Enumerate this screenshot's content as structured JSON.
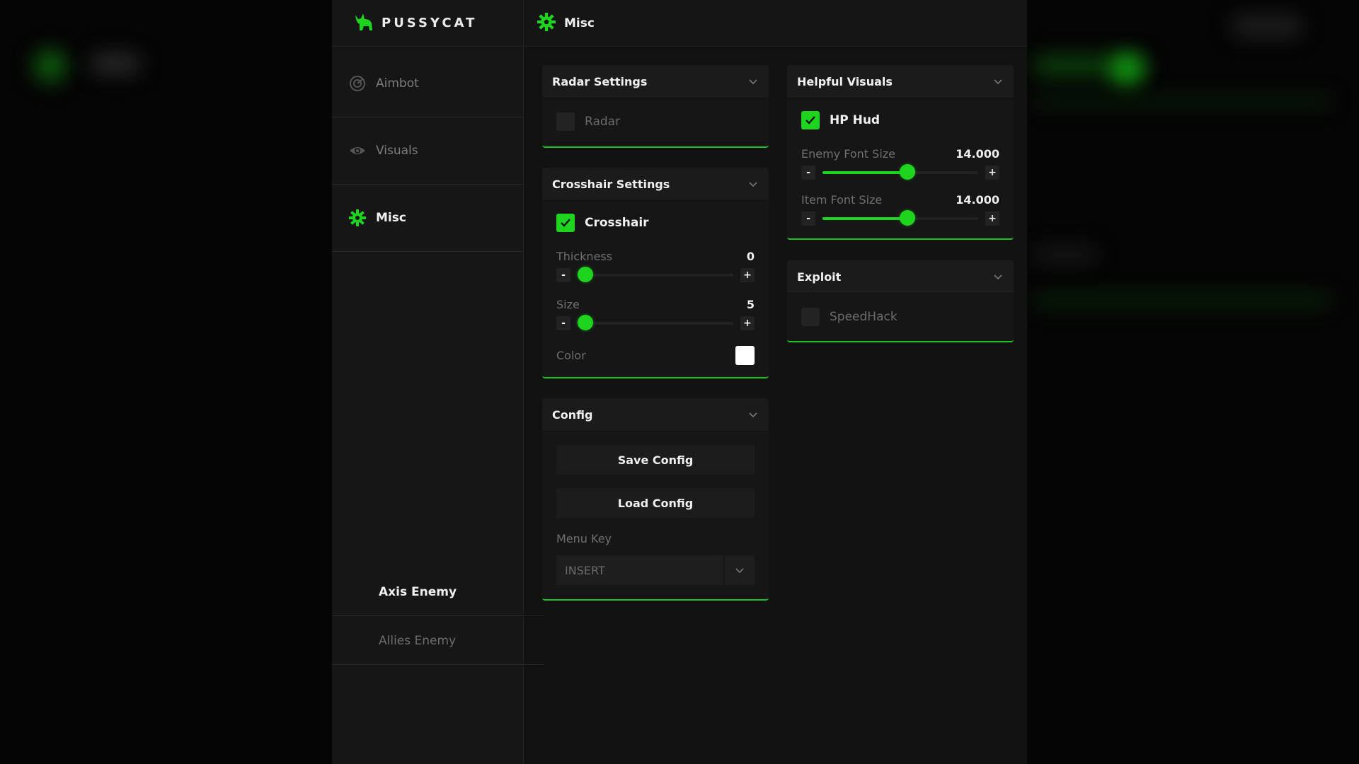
{
  "app": {
    "brand": "PUSSYCAT"
  },
  "colors": {
    "accent": "#1ed41e",
    "background": "#121212",
    "sidebar": "#161616"
  },
  "sidebar": {
    "items": [
      {
        "label": "Aimbot",
        "icon": "radar-icon"
      },
      {
        "label": "Visuals",
        "icon": "eye-icon"
      },
      {
        "label": "Misc",
        "icon": "gear-icon"
      }
    ],
    "sub_items": [
      {
        "label": "Axis Enemy"
      },
      {
        "label": "Allies Enemy"
      }
    ]
  },
  "header": {
    "title": "Misc",
    "icon": "gear-icon"
  },
  "radar_settings": {
    "title": "Radar Settings",
    "radar": {
      "label": "Radar",
      "checked": false
    }
  },
  "crosshair_settings": {
    "title": "Crosshair Settings",
    "crosshair": {
      "label": "Crosshair",
      "checked": true
    },
    "thickness": {
      "label": "Thickness",
      "value": "0",
      "fraction": 0.0
    },
    "size": {
      "label": "Size",
      "value": "5",
      "fraction": 0.0
    },
    "color": {
      "label": "Color",
      "value": "#ffffff"
    }
  },
  "config": {
    "title": "Config",
    "save_label": "Save Config",
    "load_label": "Load Config",
    "menu_key_label": "Menu Key",
    "menu_key_value": "INSERT"
  },
  "helpful_visuals": {
    "title": "Helpful Visuals",
    "hp_hud": {
      "label": "HP Hud",
      "checked": true
    },
    "enemy_font_size": {
      "label": "Enemy Font Size",
      "value": "14.000",
      "fraction": 0.55
    },
    "item_font_size": {
      "label": "Item Font Size",
      "value": "14.000",
      "fraction": 0.55
    },
    "minus": "-",
    "plus": "+"
  },
  "exploit": {
    "title": "Exploit",
    "speedhack": {
      "label": "SpeedHack",
      "checked": false
    }
  }
}
